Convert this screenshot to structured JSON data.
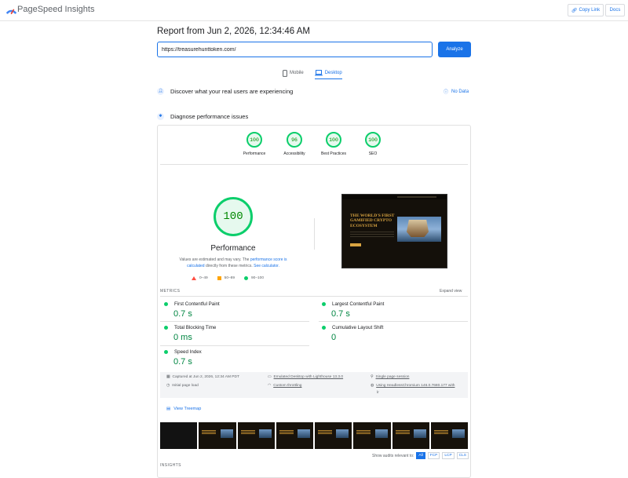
{
  "app": {
    "brand": "PageSpeed Insights"
  },
  "header": {
    "copy_link_label": "Copy Link",
    "docs_label": "Docs"
  },
  "report": {
    "title": "Report from Jun 2, 2026, 12:34:46 AM"
  },
  "search": {
    "url_value": "https://treasurehunttoken.com/",
    "analyze_label": "Analyze"
  },
  "tabs": [
    {
      "label": "Mobile",
      "active": false
    },
    {
      "label": "Desktop",
      "active": true
    }
  ],
  "field_data": {
    "heading": "Discover what your real users are experiencing",
    "no_data_label": "No Data"
  },
  "diagnose": {
    "heading": "Diagnose performance issues"
  },
  "scores": [
    {
      "label": "Performance",
      "value": "100"
    },
    {
      "label": "Accessibility",
      "value": "96"
    },
    {
      "label": "Best Practices",
      "value": "100"
    },
    {
      "label": "SEO",
      "value": "100"
    }
  ],
  "performance": {
    "score": "100",
    "title": "Performance",
    "note_1": "Values are estimated and may vary. The ",
    "note_link_1": "performance score is calculated",
    "note_2": " directly from these metrics. ",
    "note_link_2": "See calculator."
  },
  "legend": {
    "fail": "0–49",
    "average": "50–89",
    "pass": "90–100"
  },
  "screenshot": {
    "headline": "The World's First Gamified Crypto Ecosystem"
  },
  "metrics": {
    "label": "METRICS",
    "expand_label": "Expand view",
    "items": [
      {
        "name": "First Contentful Paint",
        "value": "0.7 s"
      },
      {
        "name": "Largest Contentful Paint",
        "value": "0.7 s"
      },
      {
        "name": "Total Blocking Time",
        "value": "0 ms"
      },
      {
        "name": "Cumulative Layout Shift",
        "value": "0"
      },
      {
        "name": "Speed Index",
        "value": "0.7 s"
      }
    ]
  },
  "run_info": {
    "captured": "Captured at Jun 2, 2026, 12:34 AM PDT",
    "initial_load": "Initial page load",
    "emulated": "Emulated Desktop with Lighthouse 13.3.0",
    "throttling": "Custom throttling",
    "session": "Single page session",
    "browser_line1": "Using HeadlessChromium 146.0.7680.177 with",
    "browser_line2": "lr"
  },
  "treemap": {
    "label": "View Treemap"
  },
  "audits_filter": {
    "label": "Show audits relevant to:",
    "options": [
      "All",
      "FCP",
      "LCP",
      "CLS"
    ]
  },
  "insights": {
    "label": "INSIGHTS"
  },
  "colors": {
    "accent": "#1a73e8",
    "pass": "#0cce6b",
    "average": "#ffa400",
    "fail": "#ff4e42"
  }
}
